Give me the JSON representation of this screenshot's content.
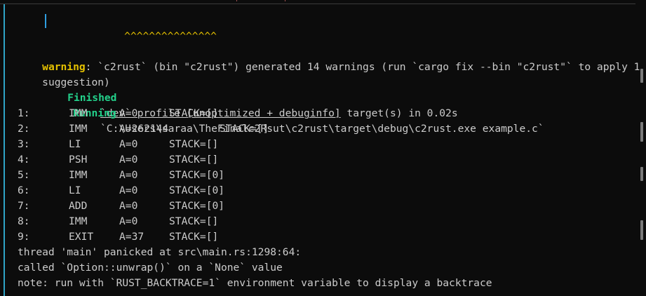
{
  "terminal": {
    "caret_line": "^^^^^^^^^^^^^^^",
    "warning": {
      "label": "warning",
      "text": ": `c2rust` (bin \"c2rust\") generated 14 warnings (run `cargo fix --bin \"c2rust\"` to apply 1",
      "text_cont": "suggestion)"
    },
    "finished": {
      "label": "Finished",
      "profile": "`dev` profile [unoptimized + debuginfo]",
      "rest": " target(s) in 0.02s"
    },
    "running": {
      "label": "Running",
      "command": "`C:\\Users\\saraa\\TheFinalc2Rsut\\c2rust\\target\\debug\\c2rust.exe example.c`"
    },
    "trace": [
      {
        "num": "1:",
        "op": "IMM",
        "a": "A=0",
        "stack": "STACK=[]"
      },
      {
        "num": "2:",
        "op": "IMM",
        "a": "A=262144",
        "stack": "STACK=[]"
      },
      {
        "num": "3:",
        "op": "LI",
        "a": "A=0",
        "stack": "STACK=[]"
      },
      {
        "num": "4:",
        "op": "PSH",
        "a": "A=0",
        "stack": "STACK=[]"
      },
      {
        "num": "5:",
        "op": "IMM",
        "a": "A=0",
        "stack": "STACK=[0]"
      },
      {
        "num": "6:",
        "op": "LI",
        "a": "A=0",
        "stack": "STACK=[0]"
      },
      {
        "num": "7:",
        "op": "ADD",
        "a": "A=0",
        "stack": "STACK=[0]"
      },
      {
        "num": "8:",
        "op": "IMM",
        "a": "A=0",
        "stack": "STACK=[]"
      },
      {
        "num": "9:",
        "op": "EXIT",
        "a": "A=37",
        "stack": "STACK=[]"
      }
    ],
    "panic_line": "thread 'main' panicked at src\\main.rs:1298:64:",
    "unwrap_line": "called `Option::unwrap()` on a `None` value",
    "note_line": "note: run with `RUST_BACKTRACE=1` environment variable to display a backtrace"
  }
}
